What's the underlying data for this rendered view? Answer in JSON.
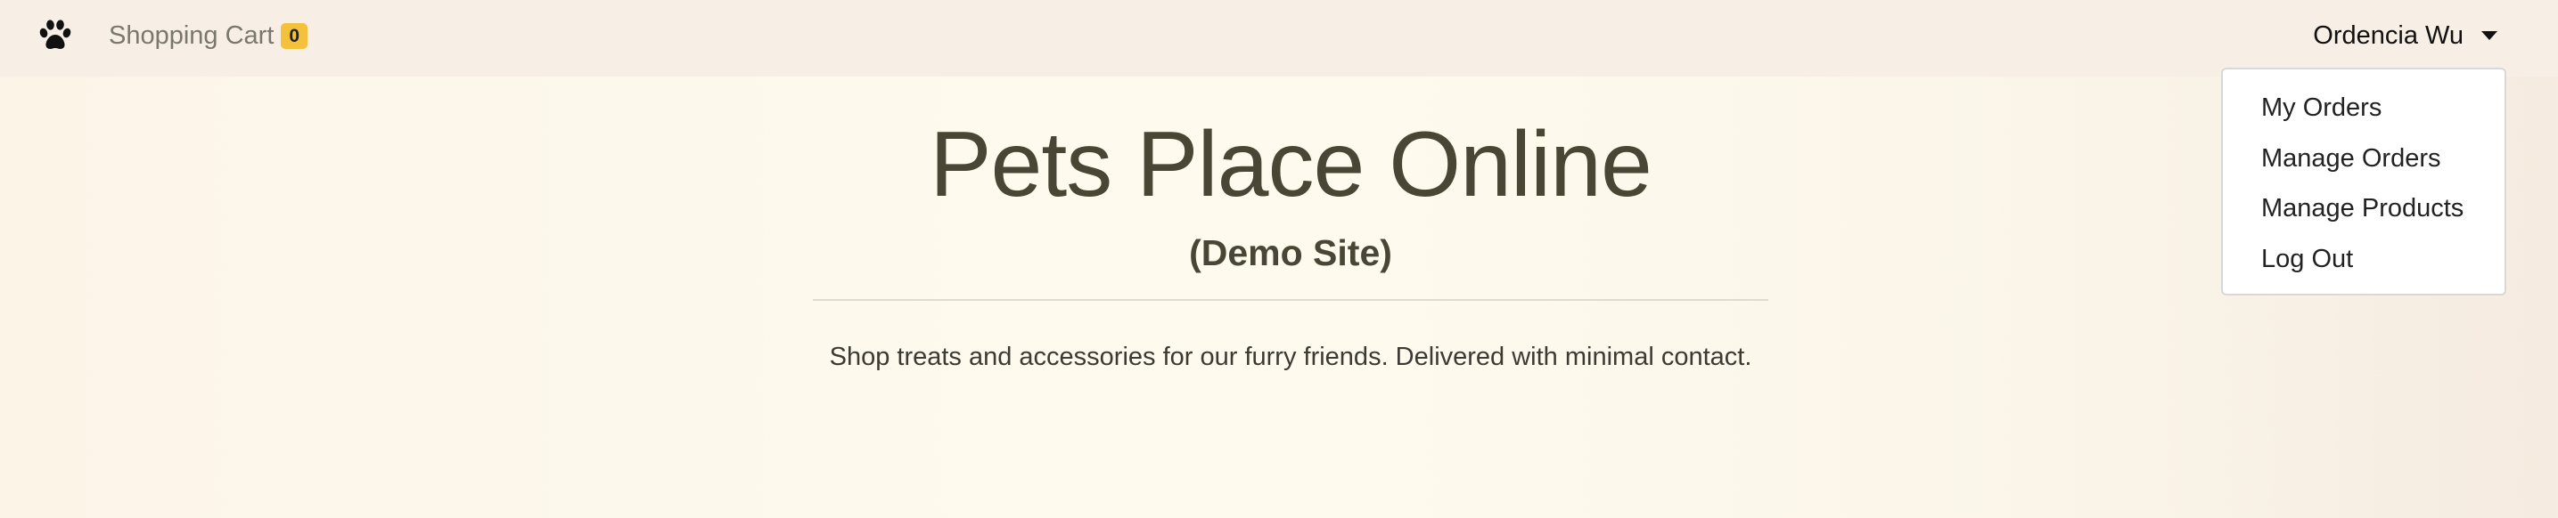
{
  "navbar": {
    "brand_icon": "paw-icon",
    "cart_label": "Shopping Cart",
    "cart_count": "0",
    "user_name": "Ordencia Wu",
    "user_menu_icon": "caret-down-icon"
  },
  "user_menu": {
    "items": [
      {
        "label": "My Orders"
      },
      {
        "label": "Manage Orders"
      },
      {
        "label": "Manage Products"
      },
      {
        "label": "Log Out"
      }
    ]
  },
  "hero": {
    "title": "Pets Place Online",
    "subtitle": "(Demo Site)",
    "tagline": "Shop treats and accessories for our furry friends. Delivered with minimal contact."
  },
  "colors": {
    "navbar_bg": "#f7efe5",
    "badge_bg": "#f4c13d",
    "heading_text": "#4a4636"
  }
}
